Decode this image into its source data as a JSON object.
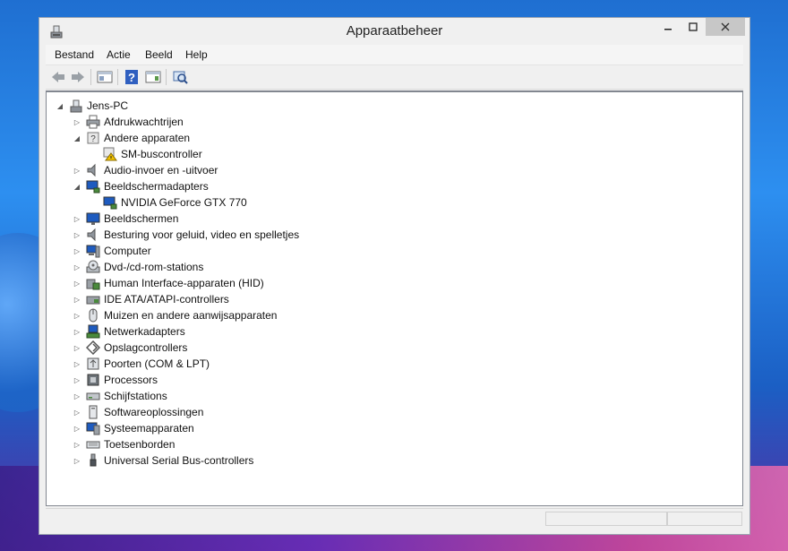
{
  "window": {
    "title": "Apparaatbeheer"
  },
  "menu": [
    "Bestand",
    "Actie",
    "Beeld",
    "Help"
  ],
  "toolbar": {
    "buttons": [
      "back-icon",
      "forward-icon",
      "properties-pane-icon",
      "help-icon",
      "view-icon",
      "scan-hardware-icon"
    ]
  },
  "tree": {
    "root": "Jens-PC",
    "items": [
      {
        "label": "Afdrukwachtrijen",
        "state": "collapsed",
        "icon": "printer-icon"
      },
      {
        "label": "Andere apparaten",
        "state": "expanded",
        "icon": "unknown-device-icon",
        "children": [
          {
            "label": "SM-buscontroller",
            "icon": "warning-device-icon"
          }
        ]
      },
      {
        "label": "Audio-invoer en -uitvoer",
        "state": "collapsed",
        "icon": "speaker-icon"
      },
      {
        "label": "Beeldschermadapters",
        "state": "expanded",
        "icon": "display-adapter-icon",
        "children": [
          {
            "label": "NVIDIA GeForce GTX 770",
            "icon": "display-adapter-icon"
          }
        ]
      },
      {
        "label": "Beeldschermen",
        "state": "collapsed",
        "icon": "monitor-icon"
      },
      {
        "label": "Besturing voor geluid, video en spelletjes",
        "state": "collapsed",
        "icon": "speaker-icon"
      },
      {
        "label": "Computer",
        "state": "collapsed",
        "icon": "computer-icon"
      },
      {
        "label": "Dvd-/cd-rom-stations",
        "state": "collapsed",
        "icon": "disc-drive-icon"
      },
      {
        "label": "Human Interface-apparaten (HID)",
        "state": "collapsed",
        "icon": "hid-icon"
      },
      {
        "label": "IDE ATA/ATAPI-controllers",
        "state": "collapsed",
        "icon": "ide-controller-icon"
      },
      {
        "label": "Muizen en andere aanwijsapparaten",
        "state": "collapsed",
        "icon": "mouse-icon"
      },
      {
        "label": "Netwerkadapters",
        "state": "collapsed",
        "icon": "network-adapter-icon"
      },
      {
        "label": "Opslagcontrollers",
        "state": "collapsed",
        "icon": "storage-controller-icon"
      },
      {
        "label": "Poorten (COM & LPT)",
        "state": "collapsed",
        "icon": "port-icon"
      },
      {
        "label": "Processors",
        "state": "collapsed",
        "icon": "processor-icon"
      },
      {
        "label": "Schijfstations",
        "state": "collapsed",
        "icon": "disk-drive-icon"
      },
      {
        "label": "Softwareoplossingen",
        "state": "collapsed",
        "icon": "software-component-icon"
      },
      {
        "label": "Systeemapparaten",
        "state": "collapsed",
        "icon": "system-device-icon"
      },
      {
        "label": "Toetsenborden",
        "state": "collapsed",
        "icon": "keyboard-icon"
      },
      {
        "label": "Universal Serial Bus-controllers",
        "state": "collapsed",
        "icon": "usb-icon"
      }
    ]
  },
  "colors": {
    "warning": "#f2c200",
    "monitor_blue": "#1e5bbf",
    "close_button": "#c7c7c7"
  }
}
